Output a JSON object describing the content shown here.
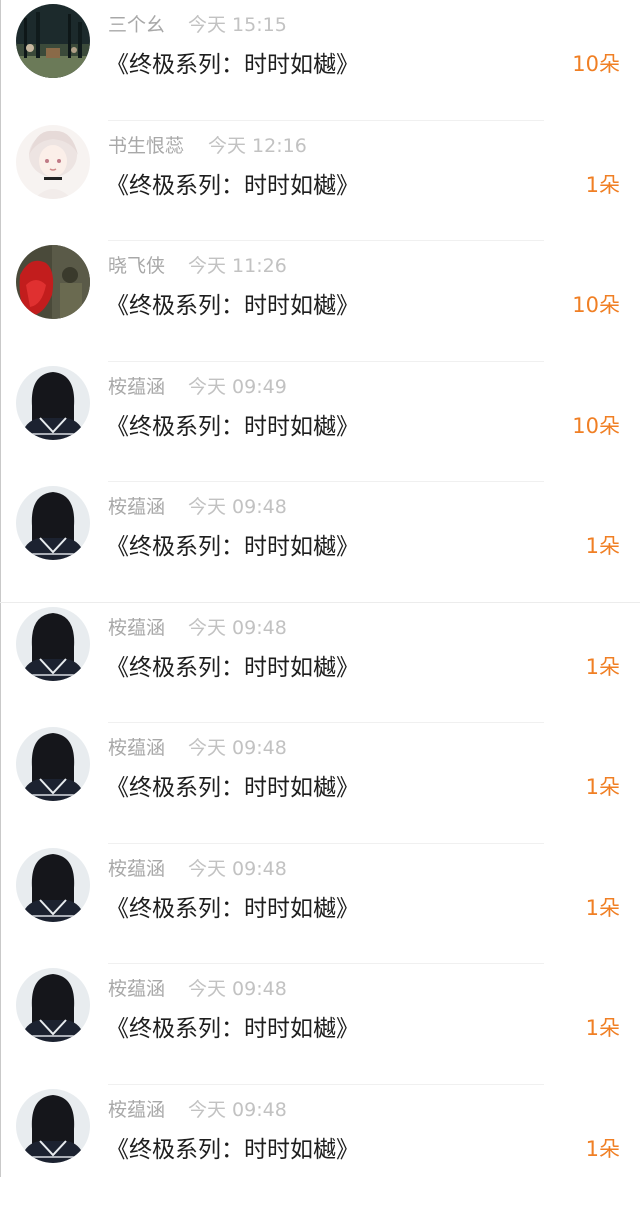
{
  "gift_list": {
    "items": [
      {
        "user": "三个幺",
        "time": "今天 15:15",
        "title": "《终极系列：时时如樾》",
        "count": "10朵",
        "avatar": "night-forest-avatar"
      },
      {
        "user": "书生恨蕊",
        "time": "今天 12:16",
        "title": "《终极系列：时时如樾》",
        "count": "1朵",
        "avatar": "anime-girl-avatar"
      },
      {
        "user": "晓飞侠",
        "time": "今天 11:26",
        "title": "《终极系列：时时如樾》",
        "count": "10朵",
        "avatar": "red-figure-avatar"
      },
      {
        "user": "桉蕴涵",
        "time": "今天 09:49",
        "title": "《终极系列：时时如樾》",
        "count": "10朵",
        "avatar": "schoolgirl-back-avatar"
      },
      {
        "user": "桉蕴涵",
        "time": "今天 09:48",
        "title": "《终极系列：时时如樾》",
        "count": "1朵",
        "avatar": "schoolgirl-back-avatar"
      },
      {
        "user": "桉蕴涵",
        "time": "今天 09:48",
        "title": "《终极系列：时时如樾》",
        "count": "1朵",
        "avatar": "schoolgirl-back-avatar"
      },
      {
        "user": "桉蕴涵",
        "time": "今天 09:48",
        "title": "《终极系列：时时如樾》",
        "count": "1朵",
        "avatar": "schoolgirl-back-avatar"
      },
      {
        "user": "桉蕴涵",
        "time": "今天 09:48",
        "title": "《终极系列：时时如樾》",
        "count": "1朵",
        "avatar": "schoolgirl-back-avatar"
      },
      {
        "user": "桉蕴涵",
        "time": "今天 09:48",
        "title": "《终极系列：时时如樾》",
        "count": "1朵",
        "avatar": "schoolgirl-back-avatar"
      },
      {
        "user": "桉蕴涵",
        "time": "今天 09:48",
        "title": "《终极系列：时时如樾》",
        "count": "1朵",
        "avatar": "schoolgirl-back-avatar"
      }
    ]
  },
  "colors": {
    "count_accent": "#f07f24",
    "username": "#a8a8a8",
    "timestamp": "#c2c2c2",
    "title_text": "#1e1e1e"
  }
}
